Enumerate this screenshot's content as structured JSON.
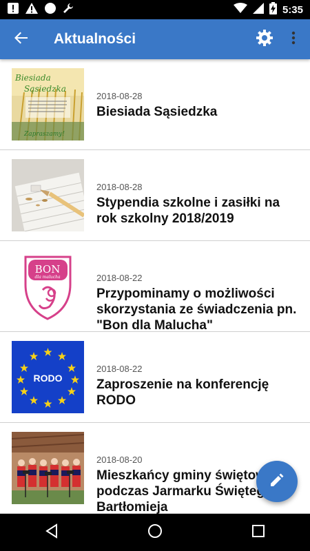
{
  "status_bar": {
    "time": "5:35",
    "icons": [
      "alert-square-icon",
      "warning-icon",
      "circle-icon",
      "wrench-icon",
      "wifi-icon",
      "signal-icon",
      "battery-charging-icon"
    ]
  },
  "app_bar": {
    "title": "Aktualności",
    "back_icon": "arrow-back-icon",
    "settings_icon": "gear-icon",
    "more_icon": "more-vertical-icon"
  },
  "news": [
    {
      "date": "2018-08-28",
      "title": "Biesiada Sąsiedzka",
      "thumb": "biesiada-poster",
      "thumb_text": "Biesiada Sąsiedzka"
    },
    {
      "date": "2018-08-28",
      "title": "Stypendia szkolne i zasiłki na rok szkolny 2018/2019",
      "thumb": "pencil-notebook"
    },
    {
      "date": "2018-08-22",
      "title": "Przypominamy o możliwości skorzystania ze świadczenia pn. \"Bon dla Malucha\"",
      "thumb": "bon-dla-malucha-logo",
      "thumb_text": "BON"
    },
    {
      "date": "2018-08-22",
      "title": "Zaproszenie na konferencję RODO",
      "thumb": "rodo-eu-flag",
      "thumb_text": "RODO"
    },
    {
      "date": "2018-08-20",
      "title": "Mieszkańcy gminy świętowali podczas Jarmarku Świętego Bartłomieja",
      "thumb": "folk-choir-photo"
    }
  ],
  "fab": {
    "icon": "pencil-icon",
    "color": "#3a78c7"
  },
  "nav_bar": {
    "icons": [
      "back-triangle-icon",
      "home-circle-icon",
      "recents-square-icon"
    ]
  },
  "colors": {
    "primary": "#3a78c7",
    "status_bar": "#000000"
  }
}
